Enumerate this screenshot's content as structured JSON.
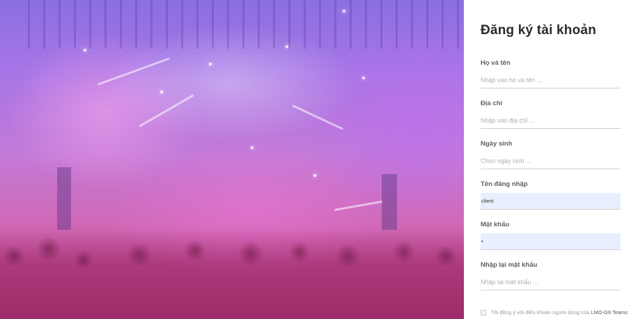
{
  "page": {
    "title": "Đăng ký tài khoản"
  },
  "form": {
    "fullname": {
      "label": "Họ và tên",
      "placeholder": "Nhập vào họ và tên ...",
      "value": ""
    },
    "address": {
      "label": "Địa chỉ",
      "placeholder": "Nhập vào địa chỉ ...",
      "value": ""
    },
    "birthday": {
      "label": "Ngày sinh",
      "placeholder": "Chọn ngày sinh ...",
      "value": ""
    },
    "username": {
      "label": "Tên đăng nhập",
      "placeholder": "",
      "value": "client"
    },
    "password": {
      "label": "Mật khẩu",
      "placeholder": "",
      "value": "•"
    },
    "confirm_password": {
      "label": "Nhập lại mật khẩu",
      "placeholder": "Nhập lại mật khẩu ...",
      "value": ""
    }
  },
  "terms": {
    "text": "Tôi đồng ý với điều khoản người dùng của",
    "brand": "LMO-G9 Teams",
    "checked": false
  },
  "colors": {
    "hero_top": "#8b6fe0",
    "hero_bottom": "#b0407f",
    "autofill_bg": "#e8effe",
    "title": "#2b2b2b"
  },
  "icons": [
    "checkbox-icon"
  ]
}
